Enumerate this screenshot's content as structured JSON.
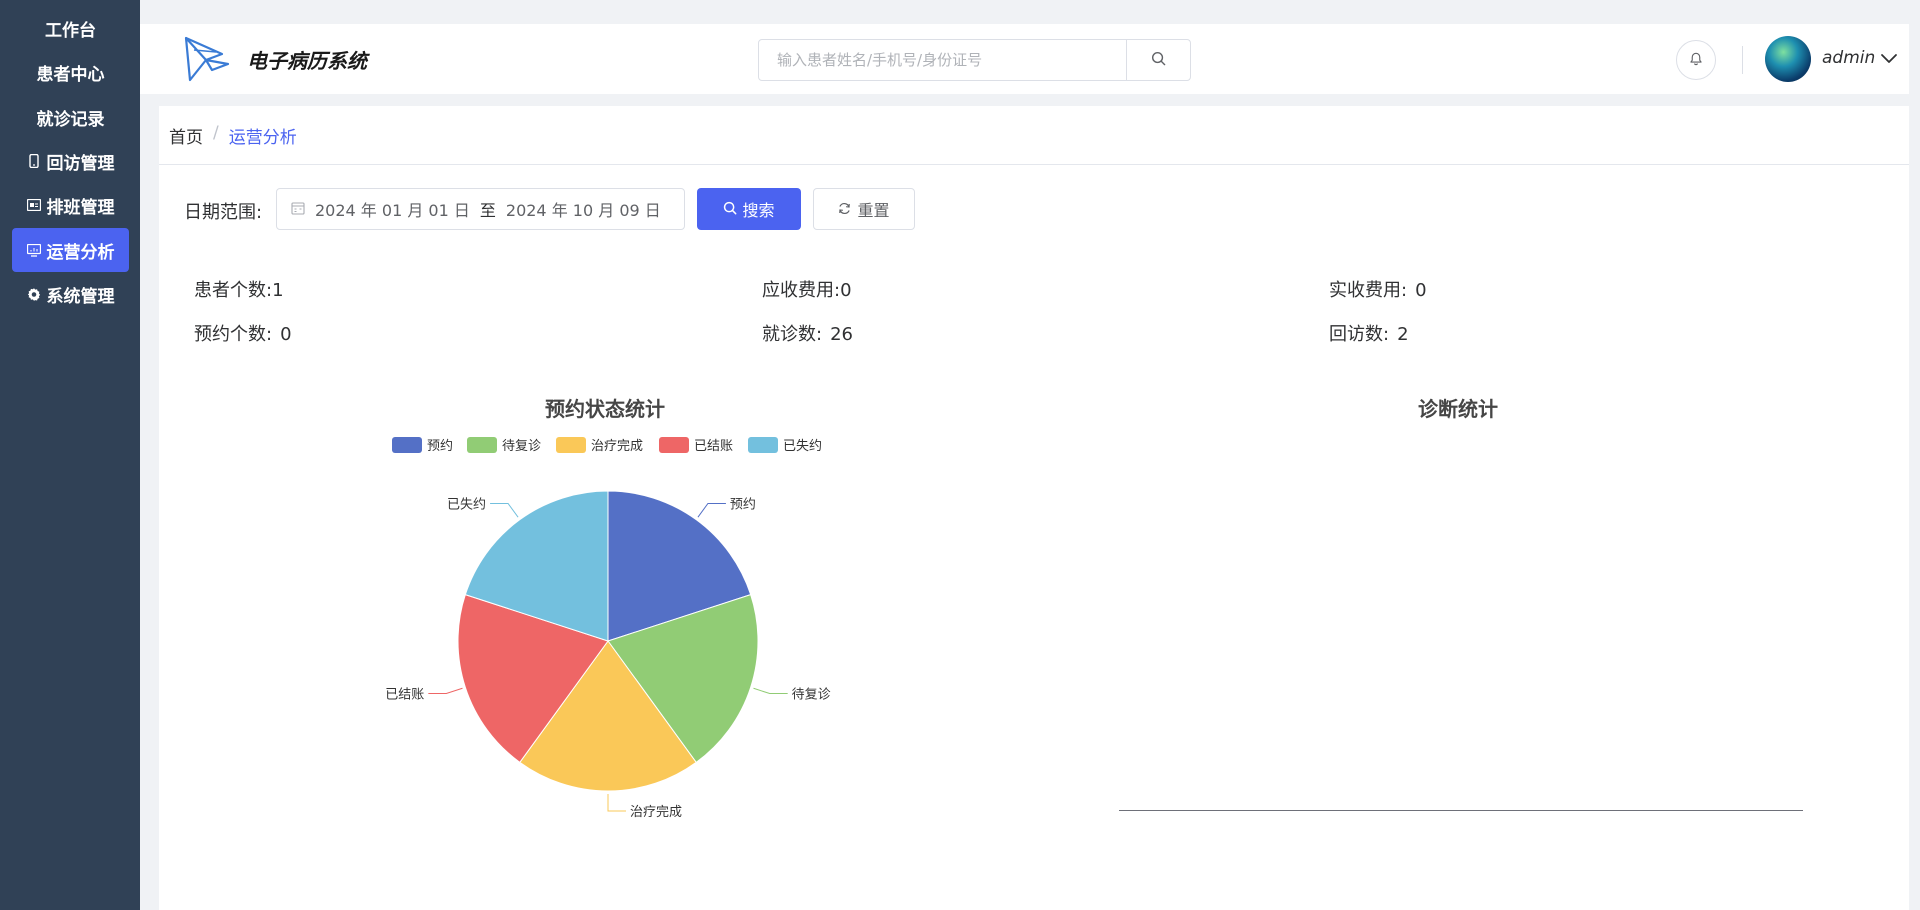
{
  "sidebar": {
    "items": [
      {
        "label": "工作台",
        "icon": "none"
      },
      {
        "label": "患者中心",
        "icon": "none"
      },
      {
        "label": "就诊记录",
        "icon": "none"
      },
      {
        "label": "回访管理",
        "icon": "mobile-icon"
      },
      {
        "label": "排班管理",
        "icon": "schedule-icon"
      },
      {
        "label": "运营分析",
        "icon": "monitor-icon",
        "active": true
      },
      {
        "label": "系统管理",
        "icon": "gear-icon"
      }
    ]
  },
  "header": {
    "title": "电子病历系统",
    "search_placeholder": "输入患者姓名/手机号/身份证号",
    "username": "admin"
  },
  "breadcrumb": {
    "home": "首页",
    "separator": "/",
    "current": "运营分析"
  },
  "filter": {
    "label": "日期范围:",
    "start_date": "2024 年 01 月 01 日",
    "range_separator": "至",
    "end_date": "2024 年 10 月 09 日",
    "search_label": "搜索",
    "reset_label": "重置"
  },
  "stats": {
    "patients": {
      "label": "患者个数:",
      "value": "1"
    },
    "receivable": {
      "label": "应收费用:",
      "value": "0"
    },
    "received": {
      "label": "实收费用:",
      "value": "0"
    },
    "appointments": {
      "label": "预约个数:",
      "value": "0"
    },
    "visits": {
      "label": "就诊数:",
      "value": "26"
    },
    "followups": {
      "label": "回访数:",
      "value": "2"
    }
  },
  "colors": {
    "accent": "#4b63f0",
    "sidebar_bg": "#304156"
  },
  "chart_data": [
    {
      "type": "pie",
      "title": "预约状态统计",
      "legend_position": "top-center",
      "slices": [
        {
          "name": "预约",
          "value": 1,
          "color": "#5470c6"
        },
        {
          "name": "待复诊",
          "value": 1,
          "color": "#91cc75"
        },
        {
          "name": "治疗完成",
          "value": 1,
          "color": "#fac858"
        },
        {
          "name": "已结账",
          "value": 1,
          "color": "#ee6666"
        },
        {
          "name": "已失约",
          "value": 1,
          "color": "#73c0de"
        }
      ]
    },
    {
      "type": "bar",
      "title": "诊断统计",
      "categories": [],
      "values": []
    }
  ]
}
